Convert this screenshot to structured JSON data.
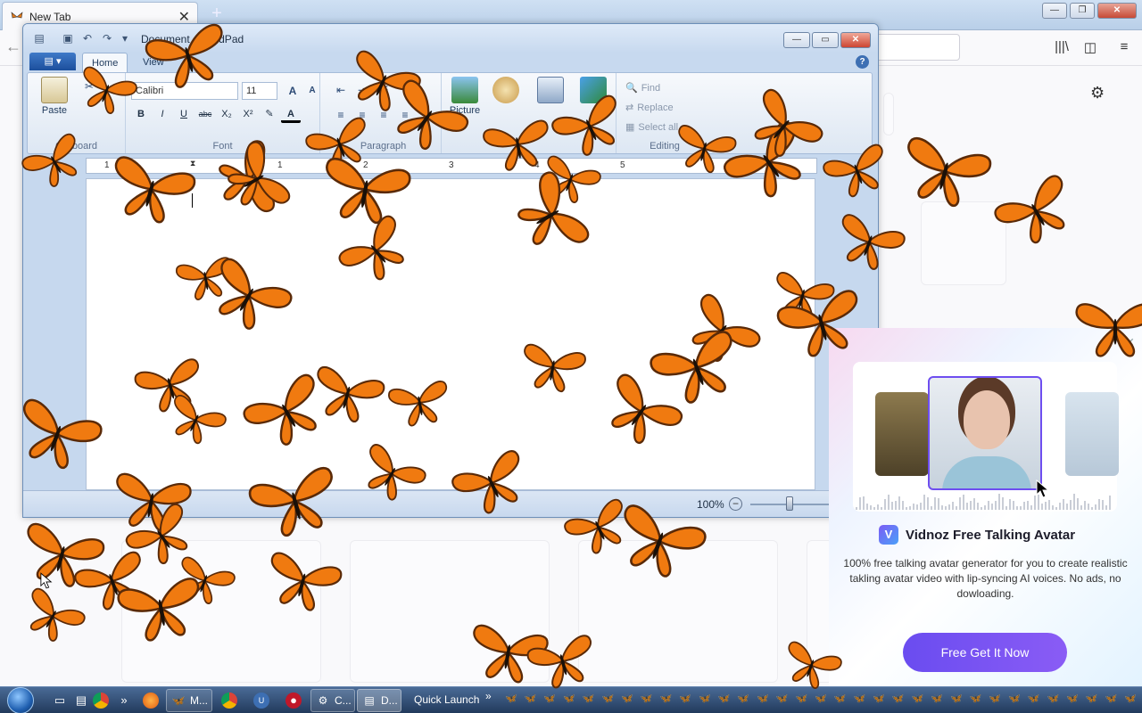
{
  "browser": {
    "tab_title": "New Tab",
    "tab_close": "✕",
    "new_tab": "+",
    "back": "←",
    "library": "|||\\",
    "sidebar": "◫",
    "menu": "≡",
    "settings_gear": "⚙",
    "window_minimize": "—",
    "window_restore": "❐",
    "window_close": "✕"
  },
  "wordpad": {
    "title": "Document - WordPad",
    "file_menu": "▤ ▾",
    "tabs": [
      {
        "label": "Home"
      },
      {
        "label": "View"
      }
    ],
    "help": "?",
    "clipboard": {
      "paste": "Paste",
      "group": "Clipboard"
    },
    "font": {
      "family": "Calibri",
      "size": "11",
      "group": "Font",
      "grow": "A",
      "shrink": "A",
      "bold": "B",
      "italic": "I",
      "underline": "U",
      "strike": "abc",
      "subscript": "X₂",
      "superscript": "X²",
      "highlight": "✎",
      "color": "A"
    },
    "paragraph": {
      "group": "Paragraph"
    },
    "insert": {
      "picture": "Picture",
      "paint": "Paint drawing",
      "datetime": "Date and time",
      "object": "Insert object",
      "group": "Insert"
    },
    "editing": {
      "find": "Find",
      "replace": "Replace",
      "select_all": "Select all",
      "group": "Editing"
    },
    "ruler_numbers": [
      "1",
      "1",
      "2",
      "3",
      "4",
      "5"
    ],
    "zoom": "100%",
    "zoom_minus": "−",
    "zoom_level": 0.4,
    "caption_buttons": {
      "minimize": "—",
      "maximize": "▭",
      "close": "✕"
    }
  },
  "ad": {
    "close": "✕",
    "brand_logo": "V",
    "brand": "Vidnoz Free Talking Avatar",
    "description": "100% free talking avatar generator for you to create realistic takling avatar video with lip-syncing AI voices. No ads, no dowloading.",
    "cta": "Free Get It Now"
  },
  "taskbar": {
    "items": [
      {
        "label": "M..."
      },
      {
        "label": "C..."
      },
      {
        "label": "D..."
      }
    ],
    "quick_launch": "Quick Launch",
    "chevron": "»",
    "butterflies": "🦋🦋🦋🦋🦋🦋🦋🦋🦋🦋🦋🦋🦋🦋🦋🦋🦋🦋🦋🦋🦋🦋🦋🦋🦋🦋🦋🦋🦋🦋🦋🦋🦋🦋🦋🦋"
  },
  "colors": {
    "butterfly_orange": "#f07a10",
    "butterfly_dark": "#5a2a08",
    "accent_purple": "#6a4cf0"
  }
}
